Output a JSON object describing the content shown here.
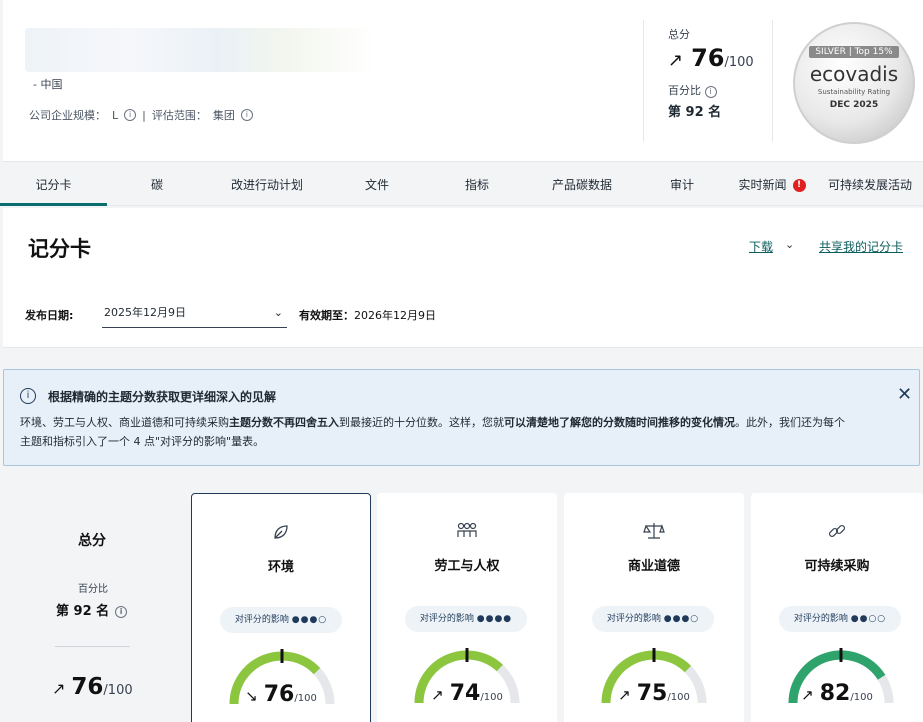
{
  "company": {
    "location": "- 中国",
    "size_label": "公司企业规模：",
    "size_value": "L",
    "scope_label": "评估范围：",
    "scope_value": "集团"
  },
  "summary": {
    "total_label": "总分",
    "score": "76",
    "denominator": "/100",
    "percentile_label": "百分比",
    "rank": "第 92 名"
  },
  "badge": {
    "tier": "SILVER | Top 15%",
    "brand": "ecovadis",
    "subtitle": "Sustainability Rating",
    "date": "DEC 2025"
  },
  "tabs": [
    "记分卡",
    "碳",
    "改进行动计划",
    "文件",
    "指标",
    "产品碳数据",
    "审计",
    "实时新闻",
    "可持续发展活动"
  ],
  "scorecard": {
    "title": "记分卡",
    "download": "下载",
    "share": "共享我的记分卡",
    "publish_label": "发布日期:",
    "publish_date": "2025年12月9日",
    "valid_label": "有效期至：",
    "valid_date": "2026年12月9日"
  },
  "banner": {
    "title": "根据精确的主题分数获取更详细深入的见解",
    "body_1": "环境、劳工与人权、商业道德和可持续采购",
    "body_2": "主题分数不再四舍五入",
    "body_3": "到最接近的十分位数。这样，您就",
    "body_4": "可以清楚地了解您的分数随时间推移的变化情况",
    "body_5": "。此外，我们还为每个主题和指标引入了一个 4 点\"对评分的影响\"量表。"
  },
  "overall": {
    "title": "总分",
    "percentile_label": "百分比",
    "rank": "第 92 名",
    "score": "76",
    "denominator": "/100"
  },
  "themes": [
    {
      "name": "环境",
      "icon": "leaf-icon",
      "impact_label": "对评分的影响",
      "impact_dots": "●●●○",
      "impact": 3,
      "score": "76",
      "score_value": 76,
      "trend": "↘",
      "denominator": "/100"
    },
    {
      "name": "劳工与人权",
      "icon": "people-icon",
      "impact_label": "对评分的影响",
      "impact_dots": "●●●●",
      "impact": 4,
      "score": "74",
      "score_value": 74,
      "trend": "↗",
      "denominator": "/100"
    },
    {
      "name": "商业道德",
      "icon": "scale-icon",
      "impact_label": "对评分的影响",
      "impact_dots": "●●●○",
      "impact": 3,
      "score": "75",
      "score_value": 75,
      "trend": "↗",
      "denominator": "/100"
    },
    {
      "name": "可持续采购",
      "icon": "chain-icon",
      "impact_label": "对评分的影响",
      "impact_dots": "●●○○",
      "impact": 2,
      "score": "82",
      "score_value": 82,
      "trend": "↗",
      "denominator": "/100"
    }
  ],
  "colors": {
    "accent": "#0b6e6e",
    "gauge_fill": "#8cc63f",
    "gauge_fill_high": "#2ea36b",
    "gauge_track": "#e5e7eb",
    "banner_bg": "#e7f0f8"
  }
}
